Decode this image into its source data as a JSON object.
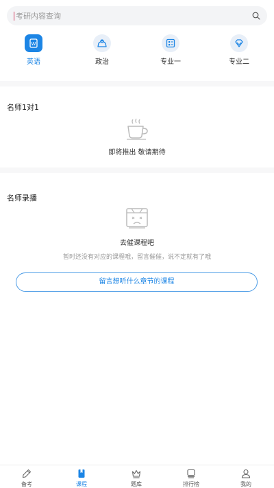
{
  "search": {
    "placeholder": "考研内容查询"
  },
  "categories": [
    {
      "label": "英语",
      "icon": "english-book-icon",
      "active": true
    },
    {
      "label": "政治",
      "icon": "politics-icon",
      "active": false
    },
    {
      "label": "专业一",
      "icon": "major-one-icon",
      "active": false
    },
    {
      "label": "专业二",
      "icon": "major-two-icon",
      "active": false
    }
  ],
  "tutor": {
    "title": "名师1对1",
    "empty_text": "即将推出 敬请期待",
    "icon": "coffee-cup-icon"
  },
  "recorded": {
    "title": "名师录播",
    "empty_title": "去催课程吧",
    "empty_sub": "暂时还没有对应的课程哦，留言催催，说不定就有了哦",
    "button_label": "留言想听什么章节的课程",
    "icon": "empty-box-icon"
  },
  "tabbar": [
    {
      "label": "备考",
      "icon": "pen-icon",
      "active": false
    },
    {
      "label": "课程",
      "icon": "course-book-icon",
      "active": true
    },
    {
      "label": "题库",
      "icon": "crown-icon",
      "active": false
    },
    {
      "label": "排行榜",
      "icon": "ranking-icon",
      "active": false
    },
    {
      "label": "我的",
      "icon": "user-icon",
      "active": false
    }
  ],
  "colors": {
    "accent": "#1c85e5",
    "icon_bg": "#e8eff8",
    "muted": "#9a9a9a"
  }
}
